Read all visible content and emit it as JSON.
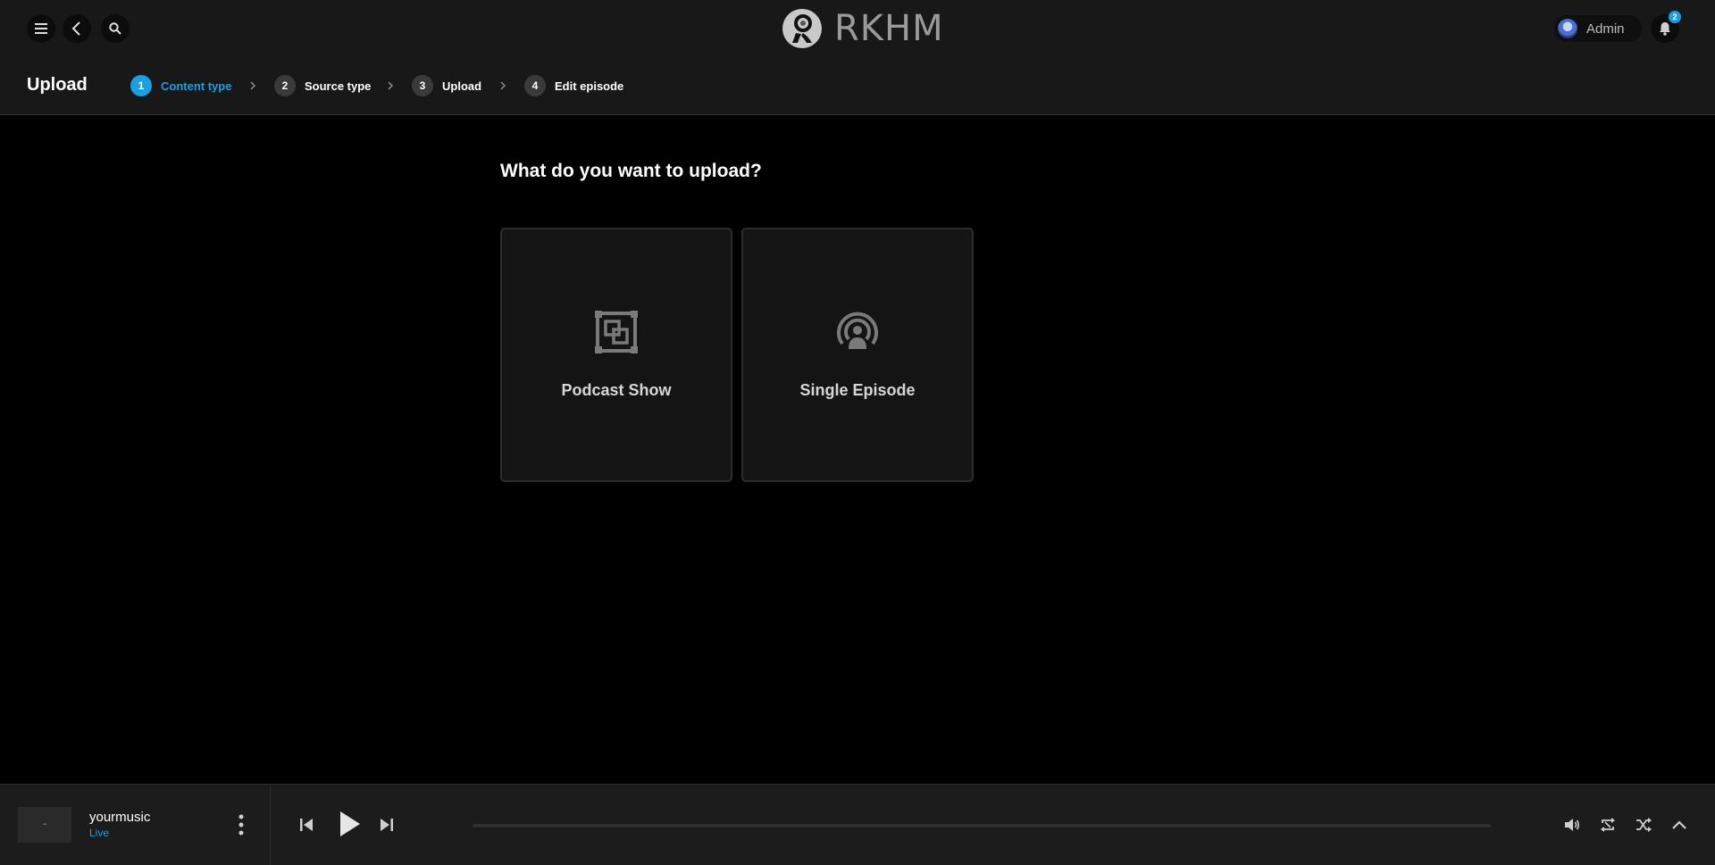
{
  "header": {
    "logo_text": "RKHM",
    "user_name": "Admin",
    "notification_count": "2"
  },
  "steps_bar": {
    "title": "Upload",
    "steps": [
      {
        "number": "1",
        "label": "Content type",
        "active": true
      },
      {
        "number": "2",
        "label": "Source type",
        "active": false
      },
      {
        "number": "3",
        "label": "Upload",
        "active": false
      },
      {
        "number": "4",
        "label": "Edit episode",
        "active": false
      }
    ]
  },
  "main": {
    "question": "What do you want to upload?",
    "options": [
      {
        "label": "Podcast Show",
        "icon": "podcast-show-icon"
      },
      {
        "label": "Single Episode",
        "icon": "podcast-episode-icon"
      }
    ]
  },
  "player": {
    "title": "yourmusic",
    "subtitle": "Live",
    "progress": 0
  },
  "colors": {
    "accent": "#1aa0e0",
    "background": "#000000",
    "bar": "#181818"
  }
}
